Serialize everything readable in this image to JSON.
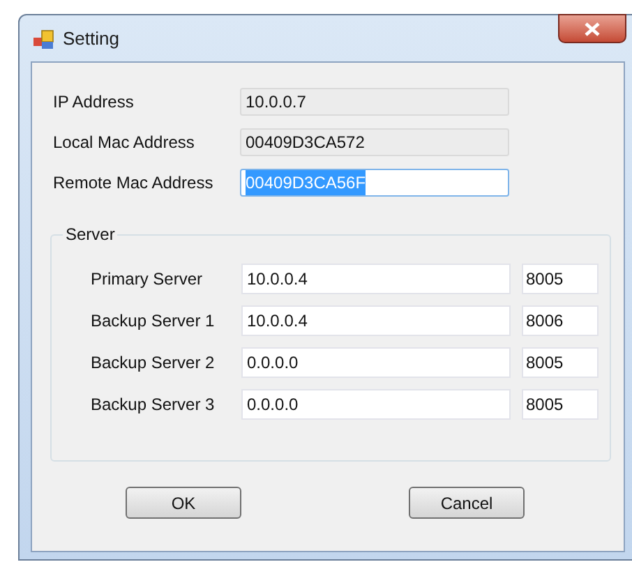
{
  "window": {
    "title": "Setting"
  },
  "fields": [
    {
      "label": "IP Address",
      "value": "10.0.0.7",
      "read_only": true,
      "text_selected": false
    },
    {
      "label": "Local Mac Address",
      "value": "00409D3CA572",
      "read_only": true,
      "text_selected": false
    },
    {
      "label": "Remote Mac Address",
      "value": "00409D3CA56F",
      "read_only": false,
      "text_selected": true
    }
  ],
  "server_group": {
    "title": "Server",
    "rows": [
      {
        "label": "Primary Server",
        "address": "10.0.0.4",
        "port": "8005"
      },
      {
        "label": "Backup Server 1",
        "address": "10.0.0.4",
        "port": "8006"
      },
      {
        "label": "Backup Server 2",
        "address": "0.0.0.0",
        "port": "8005"
      },
      {
        "label": "Backup Server 3",
        "address": "0.0.0.0",
        "port": "8005"
      }
    ]
  },
  "buttons": [
    "OK",
    "Cancel"
  ]
}
